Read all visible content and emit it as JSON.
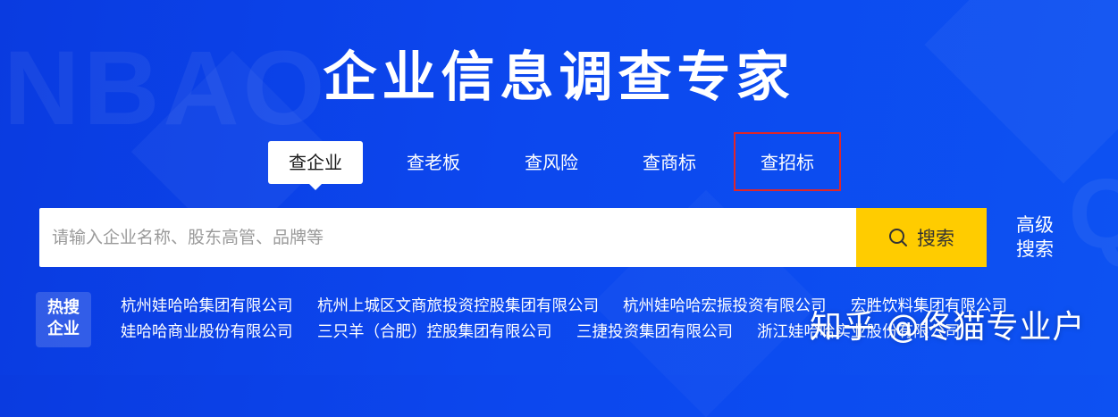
{
  "header": {
    "title": "企业信息调查专家"
  },
  "tabs": [
    {
      "label": "查企业"
    },
    {
      "label": "查老板"
    },
    {
      "label": "查风险"
    },
    {
      "label": "查商标"
    },
    {
      "label": "查招标"
    }
  ],
  "search": {
    "placeholder": "请输入企业名称、股东高管、品牌等",
    "button_label": "搜索",
    "advanced_line1": "高级",
    "advanced_line2": "搜索"
  },
  "hot": {
    "badge_line1": "热搜",
    "badge_line2": "企业",
    "links": [
      "杭州娃哈哈集团有限公司",
      "杭州上城区文商旅投资控股集团有限公司",
      "杭州娃哈哈宏振投资有限公司",
      "宏胜饮料集团有限公司",
      "娃哈哈商业股份有限公司",
      "三只羊（合肥）控股集团有限公司",
      "三捷投资集团有限公司",
      "浙江娃哈哈实业股份有限公司"
    ]
  },
  "watermark": {
    "text": "知乎 @佟猫专业户"
  },
  "background": {
    "word_left": "NBAO",
    "word_right": "Q"
  },
  "colors": {
    "background": "#0c47ee",
    "search_button": "#ffcc00",
    "highlight_border": "#e0262a"
  }
}
